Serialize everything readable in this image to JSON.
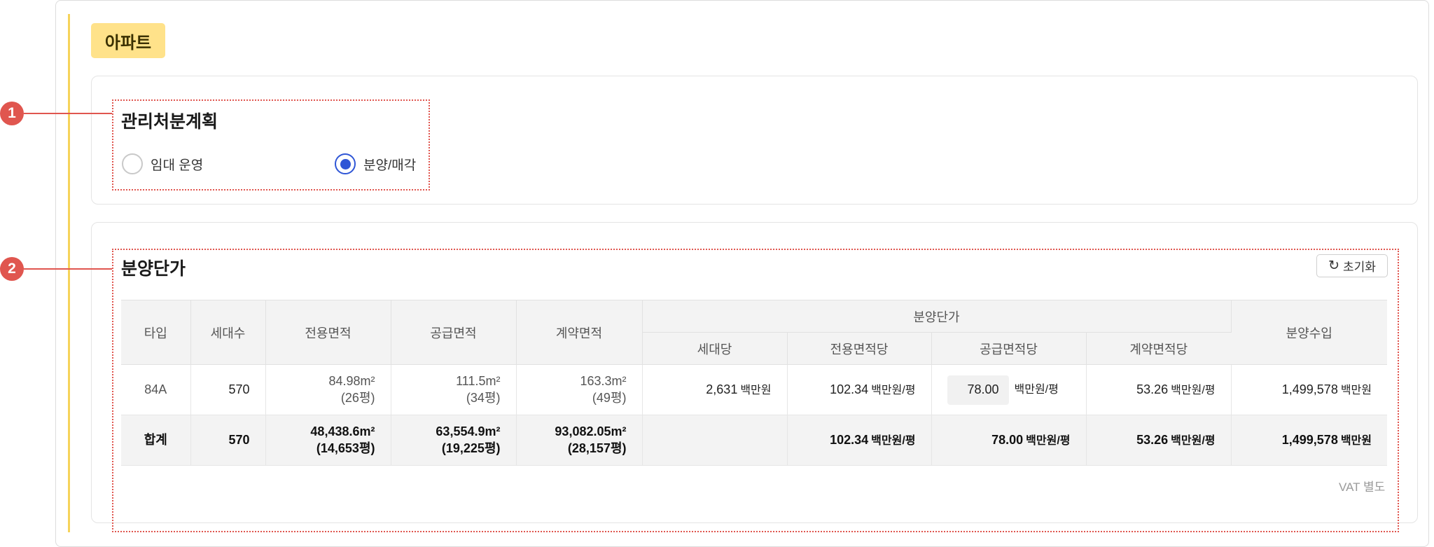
{
  "category": "아파트",
  "markers": [
    "1",
    "2"
  ],
  "plan": {
    "title": "관리처분계획",
    "options": [
      {
        "label": "임대 운영",
        "checked": false
      },
      {
        "label": "분양/매각",
        "checked": true
      }
    ]
  },
  "pricing": {
    "title": "분양단가",
    "reset_label": "초기화",
    "reset_icon": "refresh-icon",
    "vat_note": "VAT 별도",
    "headers": {
      "type": "타입",
      "households": "세대수",
      "exclusive_area": "전용면적",
      "supply_area": "공급면적",
      "contract_area": "계약면적",
      "unit_price_group": "분양단가",
      "per_household": "세대당",
      "per_exclusive": "전용면적당",
      "per_supply": "공급면적당",
      "per_contract": "계약면적당",
      "revenue": "분양수입"
    },
    "rows": [
      {
        "type": "84A",
        "households": "570",
        "exclusive_area": "84.98m²",
        "exclusive_pyeong": "(26평)",
        "supply_area": "111.5m²",
        "supply_pyeong": "(34평)",
        "contract_area": "163.3m²",
        "contract_pyeong": "(49평)",
        "per_household": "2,631",
        "per_household_unit": "백만원",
        "per_exclusive": "102.34",
        "per_exclusive_unit": "백만원/평",
        "per_supply": "78.00",
        "per_supply_unit": "백만원/평",
        "per_contract": "53.26",
        "per_contract_unit": "백만원/평",
        "revenue": "1,499,578",
        "revenue_unit": "백만원"
      }
    ],
    "total": {
      "label": "합계",
      "households": "570",
      "exclusive_area": "48,438.6m²",
      "exclusive_pyeong": "(14,653평)",
      "supply_area": "63,554.9m²",
      "supply_pyeong": "(19,225평)",
      "contract_area": "93,082.05m²",
      "contract_pyeong": "(28,157평)",
      "per_exclusive": "102.34",
      "per_exclusive_unit": "백만원/평",
      "per_supply": "78.00",
      "per_supply_unit": "백만원/평",
      "per_contract": "53.26",
      "per_contract_unit": "백만원/평",
      "revenue": "1,499,578",
      "revenue_unit": "백만원"
    }
  },
  "colors": {
    "accent_yellow": "#f6d35a",
    "tag_background": "#ffe28a",
    "annotation_red": "#e0564f",
    "radio_blue": "#2f56d6"
  }
}
